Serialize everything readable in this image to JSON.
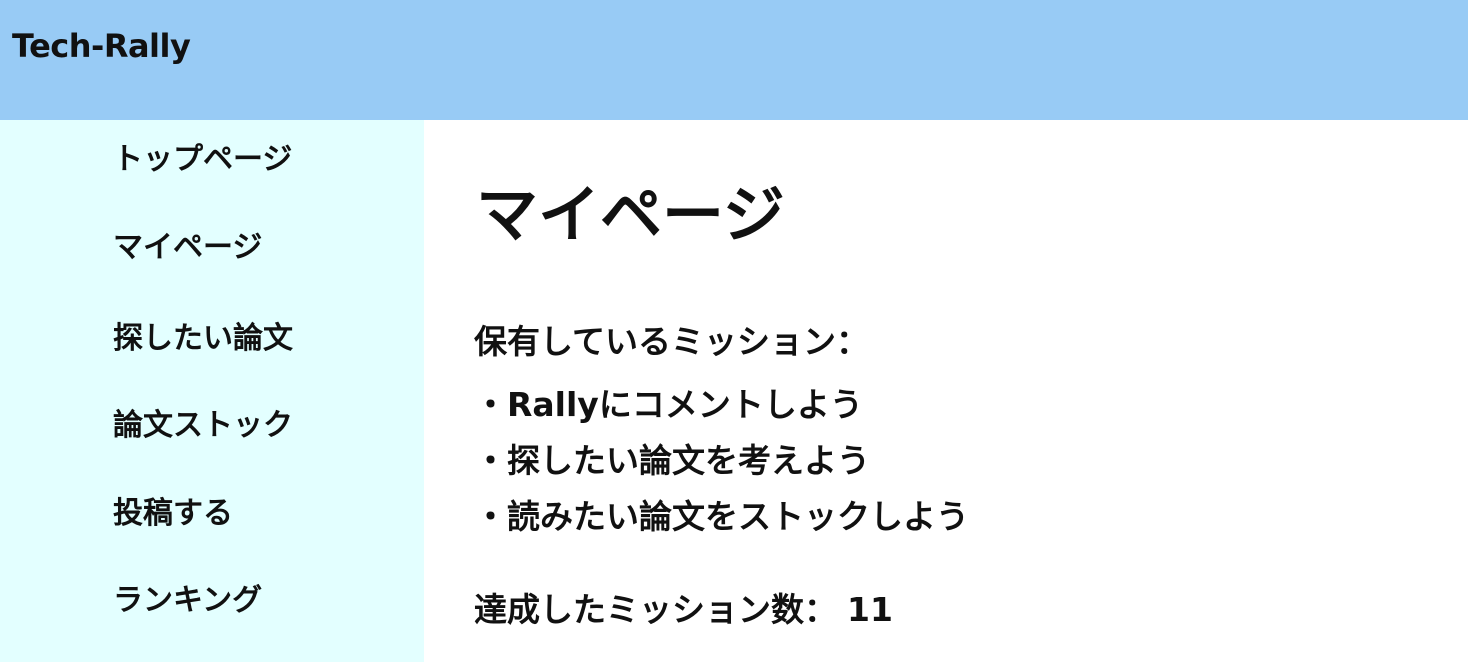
{
  "header": {
    "brand": "Tech-Rally"
  },
  "sidebar": {
    "items": [
      {
        "label": "トップページ"
      },
      {
        "label": "マイページ"
      },
      {
        "label": "探したい論文"
      },
      {
        "label": "論文ストック"
      },
      {
        "label": "投稿する"
      },
      {
        "label": "ランキング"
      }
    ]
  },
  "main": {
    "title": "マイページ",
    "missions_label": "保有しているミッション：",
    "missions": [
      "・Rallyにコメントしよう",
      "・探したい論文を考えよう",
      "・読みたい論文をストックしよう"
    ],
    "achieved_label": "達成したミッション数：",
    "achieved_count": "11"
  },
  "colors": {
    "header_bg": "#98CBF5",
    "sidebar_bg": "#E3FFFF",
    "content_bg": "#FFFFFF",
    "text": "#111111"
  }
}
